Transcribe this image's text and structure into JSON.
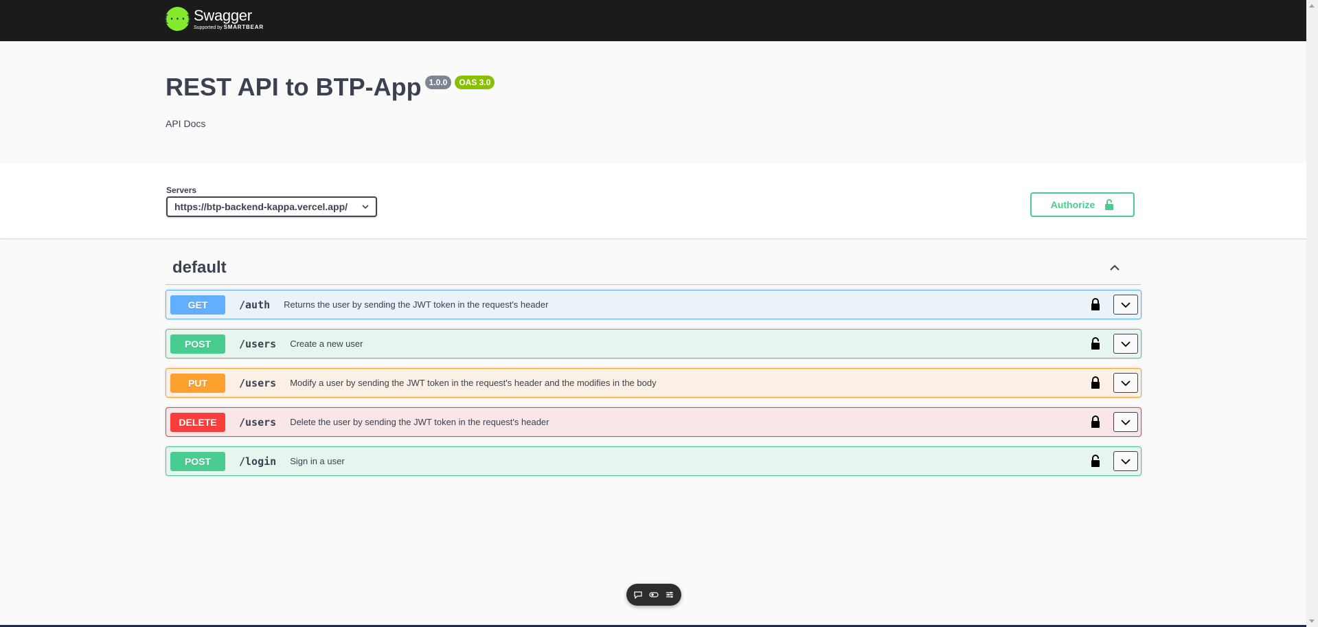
{
  "topbar": {
    "logo_symbol": "{···}",
    "logo_name": "Swagger",
    "logo_sub_prefix": "Supported by",
    "logo_sub_brand": "SMARTBEAR"
  },
  "info": {
    "title": "REST API to BTP-App",
    "version": "1.0.0",
    "oas": "OAS 3.0",
    "description": "API Docs"
  },
  "servers": {
    "label": "Servers",
    "selected": "https://btp-backend-kappa.vercel.app/"
  },
  "authorize": {
    "label": "Authorize",
    "color": "#49cc90"
  },
  "tag": {
    "name": "default"
  },
  "operations": [
    {
      "method": "GET",
      "path": "/auth",
      "summary": "Returns the user by sending the JWT token in the request's header",
      "color": "#61affe"
    },
    {
      "method": "POST",
      "path": "/users",
      "summary": "Create a new user",
      "color": "#49cc90"
    },
    {
      "method": "PUT",
      "path": "/users",
      "summary": "Modify a user by sending the JWT token in the request's header and the modifies in the body",
      "color": "#fca130"
    },
    {
      "method": "DELETE",
      "path": "/users",
      "summary": "Delete the user by sending the JWT token in the request's header",
      "color": "#f93e3e"
    },
    {
      "method": "POST",
      "path": "/login",
      "summary": "Sign in a user",
      "color": "#49cc90"
    }
  ],
  "icons": {
    "lock": "lock-icon",
    "unlock": "unlock-icon",
    "chevron_down": "chevron-down-icon",
    "chevron_up": "chevron-up-icon"
  }
}
